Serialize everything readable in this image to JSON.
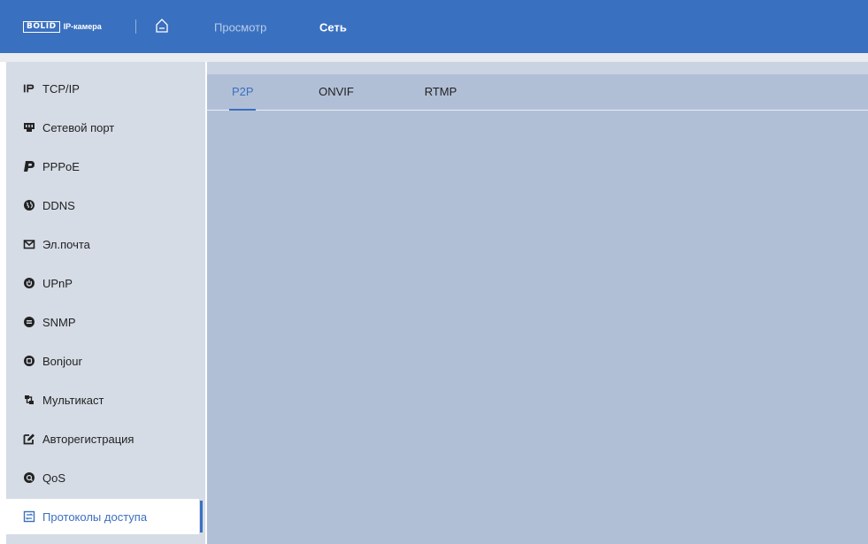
{
  "header": {
    "logo_box": "BOLID",
    "logo_text": "IP-камера",
    "nav": [
      {
        "label": "Просмотр",
        "active": false
      },
      {
        "label": "Сеть",
        "active": true
      }
    ],
    "accent_color": "#3a70c0"
  },
  "sidebar": {
    "items": [
      {
        "label": "TCP/IP",
        "icon": "ip-icon"
      },
      {
        "label": "Сетевой порт",
        "icon": "network-port-icon"
      },
      {
        "label": "PPPoE",
        "icon": "pppoe-icon"
      },
      {
        "label": "DDNS",
        "icon": "globe-icon"
      },
      {
        "label": "Эл.почта",
        "icon": "mail-icon"
      },
      {
        "label": "UPnP",
        "icon": "power-icon"
      },
      {
        "label": "SNMP",
        "icon": "snmp-icon"
      },
      {
        "label": "Bonjour",
        "icon": "bonjour-icon"
      },
      {
        "label": "Мультикаст",
        "icon": "multicast-icon"
      },
      {
        "label": "Авторегистрация",
        "icon": "edit-icon"
      },
      {
        "label": "QoS",
        "icon": "qos-icon"
      },
      {
        "label": "Протоколы доступа",
        "icon": "access-protocols-icon",
        "active": true
      }
    ]
  },
  "main": {
    "tabs": [
      {
        "label": "P2P",
        "active": true
      },
      {
        "label": "ONVIF",
        "active": false
      },
      {
        "label": "RTMP",
        "active": false
      }
    ]
  }
}
